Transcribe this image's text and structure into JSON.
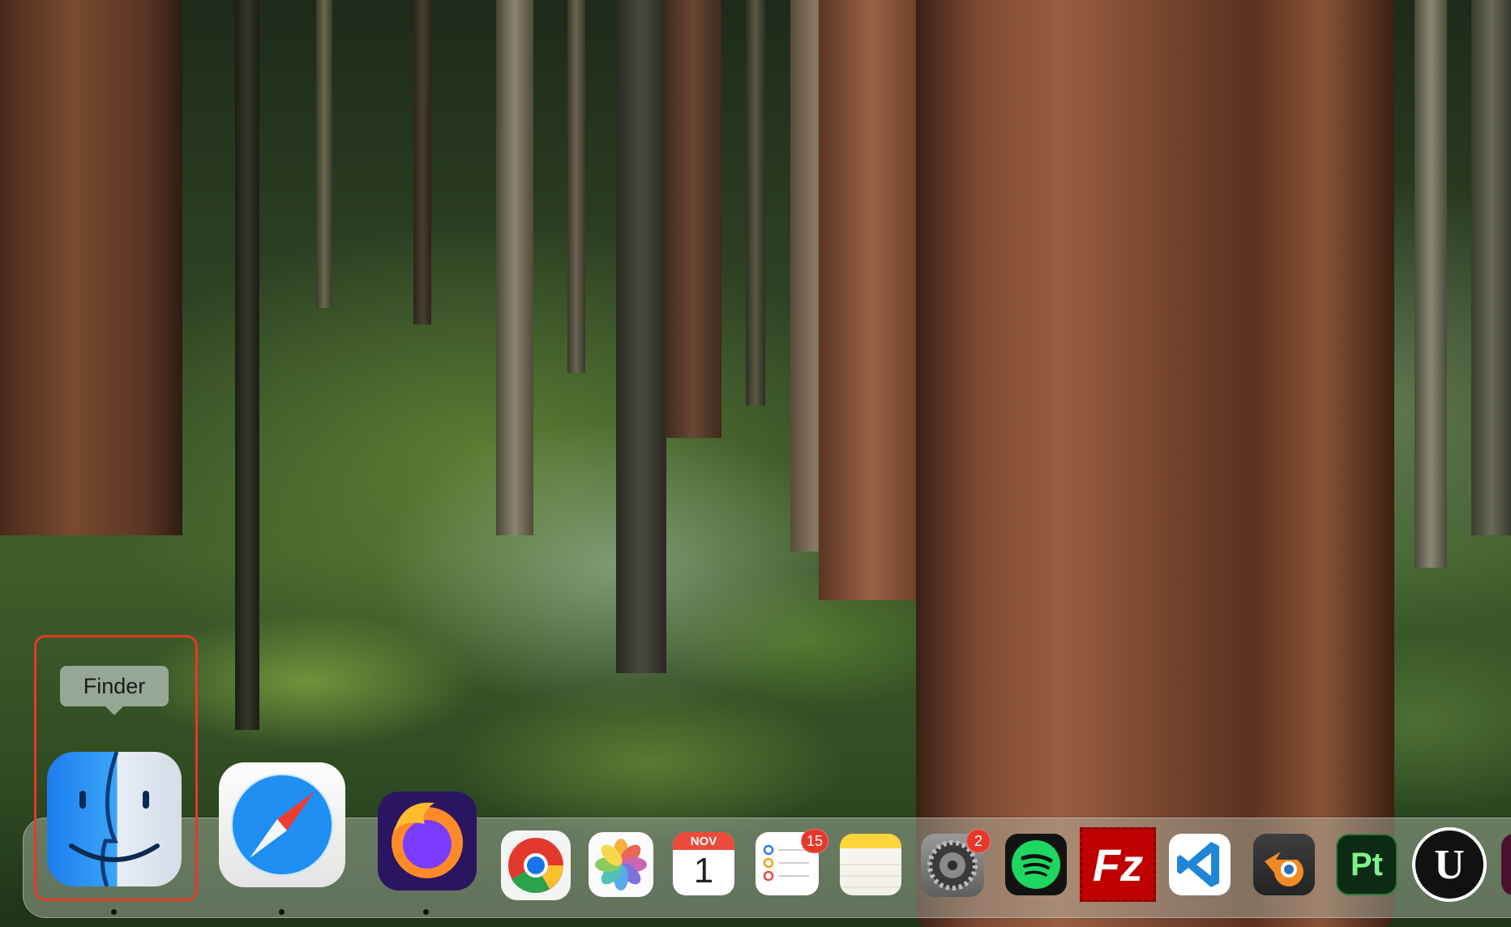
{
  "tooltip": {
    "label": "Finder"
  },
  "dock": {
    "apps": [
      {
        "id": "finder",
        "name": "Finder",
        "running": true
      },
      {
        "id": "safari",
        "name": "Safari",
        "running": true
      },
      {
        "id": "firefox",
        "name": "Firefox",
        "running": true
      },
      {
        "id": "chrome",
        "name": "Google Chrome",
        "running": false
      },
      {
        "id": "photos",
        "name": "Photos",
        "running": false
      },
      {
        "id": "calendar",
        "name": "Calendar",
        "running": false,
        "month": "NOV",
        "day": "1"
      },
      {
        "id": "reminders",
        "name": "Reminders",
        "running": false,
        "badge": "15"
      },
      {
        "id": "notes",
        "name": "Notes",
        "running": false
      },
      {
        "id": "system-settings",
        "name": "System Settings",
        "running": false,
        "badge": "2"
      },
      {
        "id": "spotify",
        "name": "Spotify",
        "running": false
      },
      {
        "id": "filezilla",
        "name": "FileZilla",
        "running": false,
        "glyph": "Fz"
      },
      {
        "id": "vscode",
        "name": "Visual Studio Code",
        "running": false
      },
      {
        "id": "blender",
        "name": "Blender",
        "running": false
      },
      {
        "id": "painter",
        "name": "Substance 3D Painter",
        "running": false,
        "glyph": "Pt"
      },
      {
        "id": "unreal",
        "name": "Unreal Engine",
        "running": false,
        "glyph": "U"
      }
    ]
  },
  "colors": {
    "highlight": "#e63a25",
    "badge": "#e7372b",
    "dock_tint": "rgba(190,200,185,0.42)"
  }
}
